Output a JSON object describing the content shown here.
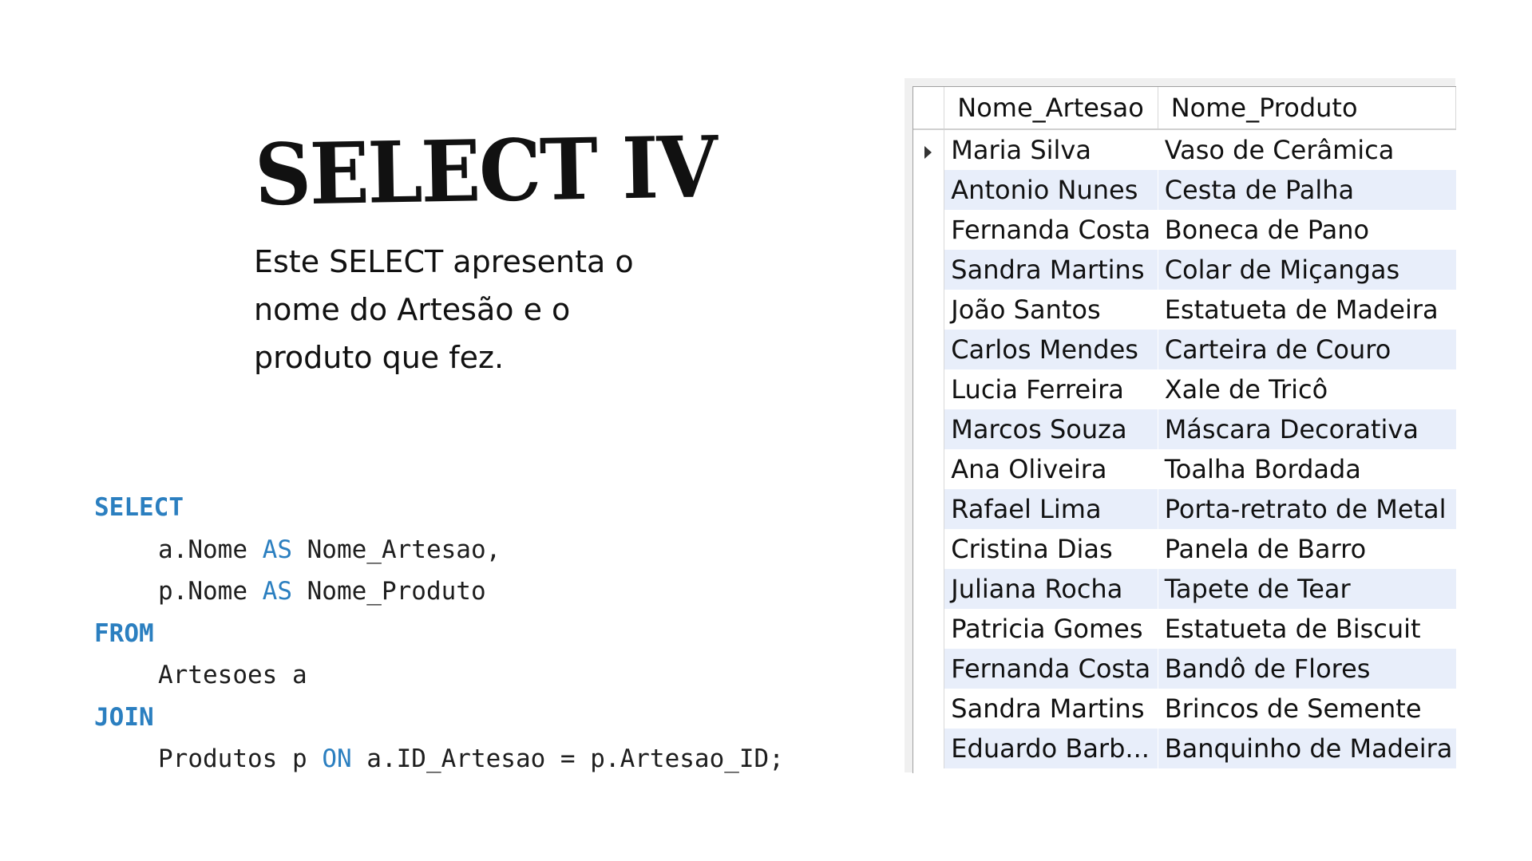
{
  "slide": {
    "title": "SELECT IV",
    "description_lines": [
      "Este SELECT apresenta o",
      "nome do Artesão e o",
      "produto que fez."
    ]
  },
  "sql": {
    "kw_select": "SELECT",
    "line1_expr": "a.Nome ",
    "line1_as": "AS",
    "line1_alias": " Nome_Artesao,",
    "line2_expr": "p.Nome ",
    "line2_as": "AS",
    "line2_alias": " Nome_Produto",
    "kw_from": "FROM",
    "from_table": "Artesoes a",
    "kw_join": "JOIN",
    "join_table": "Produtos p ",
    "join_on": "ON",
    "join_condition": " a.ID_Artesao = p.Artesao_ID;"
  },
  "result_grid": {
    "columns": [
      "Nome_Artesao",
      "Nome_Produto"
    ],
    "current_row_index": 0,
    "rows": [
      [
        "Maria Silva",
        "Vaso de Cerâmica"
      ],
      [
        "Antonio Nunes",
        "Cesta de Palha"
      ],
      [
        "Fernanda Costa",
        "Boneca de Pano"
      ],
      [
        "Sandra Martins",
        "Colar de Miçangas"
      ],
      [
        "João Santos",
        "Estatueta de Madeira"
      ],
      [
        "Carlos Mendes",
        "Carteira de Couro"
      ],
      [
        "Lucia Ferreira",
        "Xale de Tricô"
      ],
      [
        "Marcos Souza",
        "Máscara Decorativa"
      ],
      [
        "Ana Oliveira",
        "Toalha Bordada"
      ],
      [
        "Rafael Lima",
        "Porta-retrato de Metal"
      ],
      [
        "Cristina Dias",
        "Panela de Barro"
      ],
      [
        "Juliana Rocha",
        "Tapete de Tear"
      ],
      [
        "Patricia Gomes",
        "Estatueta de Biscuit"
      ],
      [
        "Fernanda Costa",
        "Bandô de Flores"
      ],
      [
        "Sandra Martins",
        "Brincos de Semente"
      ],
      [
        "Eduardo Barb...",
        "Banquinho de Madeira"
      ]
    ]
  },
  "colors": {
    "keyword": "#2b7fc0",
    "alt_row": "#e8eefa"
  }
}
